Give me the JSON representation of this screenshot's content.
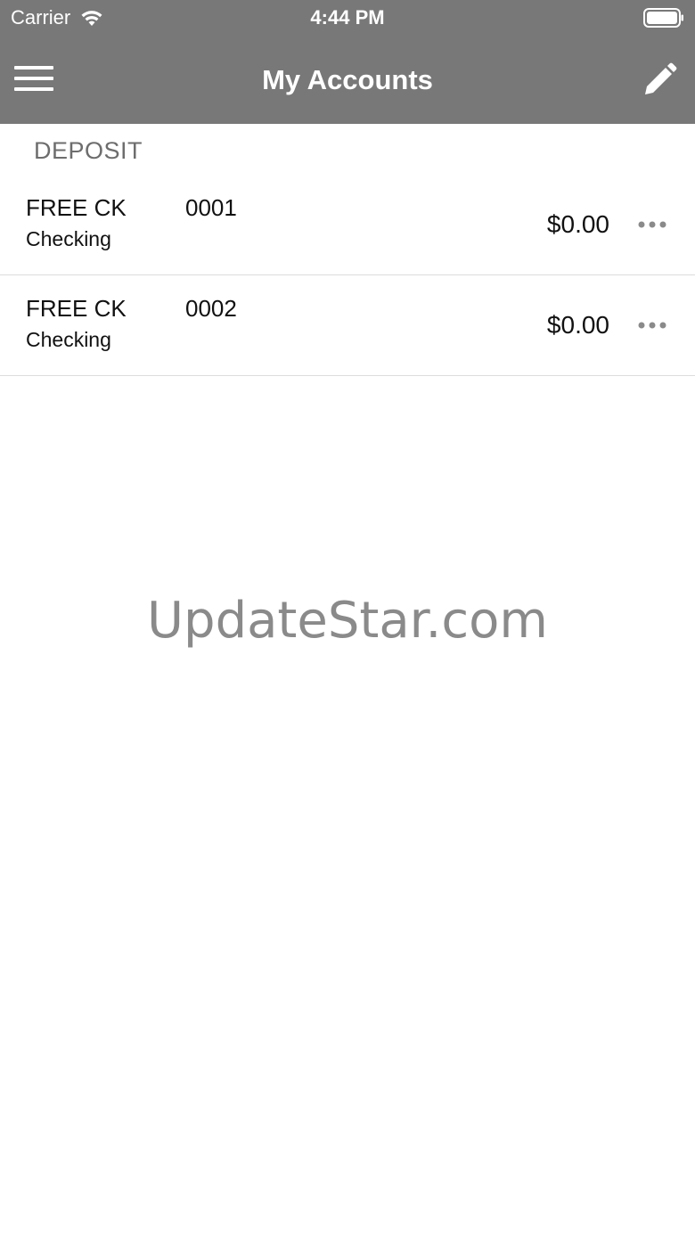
{
  "status_bar": {
    "carrier": "Carrier",
    "time": "4:44 PM",
    "wifi_icon": "wifi-icon",
    "battery_icon": "battery-icon"
  },
  "nav_bar": {
    "title": "My Accounts",
    "menu_icon": "hamburger-menu-icon",
    "edit_icon": "pencil-icon",
    "background_color": "#787878"
  },
  "section": {
    "header": "DEPOSIT"
  },
  "accounts": [
    {
      "name": "FREE CK",
      "number": "0001",
      "type": "Checking",
      "balance": "$0.00",
      "more_icon": "more-dots-icon"
    },
    {
      "name": "FREE CK",
      "number": "0002",
      "type": "Checking",
      "balance": "$0.00",
      "more_icon": "more-dots-icon"
    }
  ],
  "watermark": "UpdateStar.com"
}
